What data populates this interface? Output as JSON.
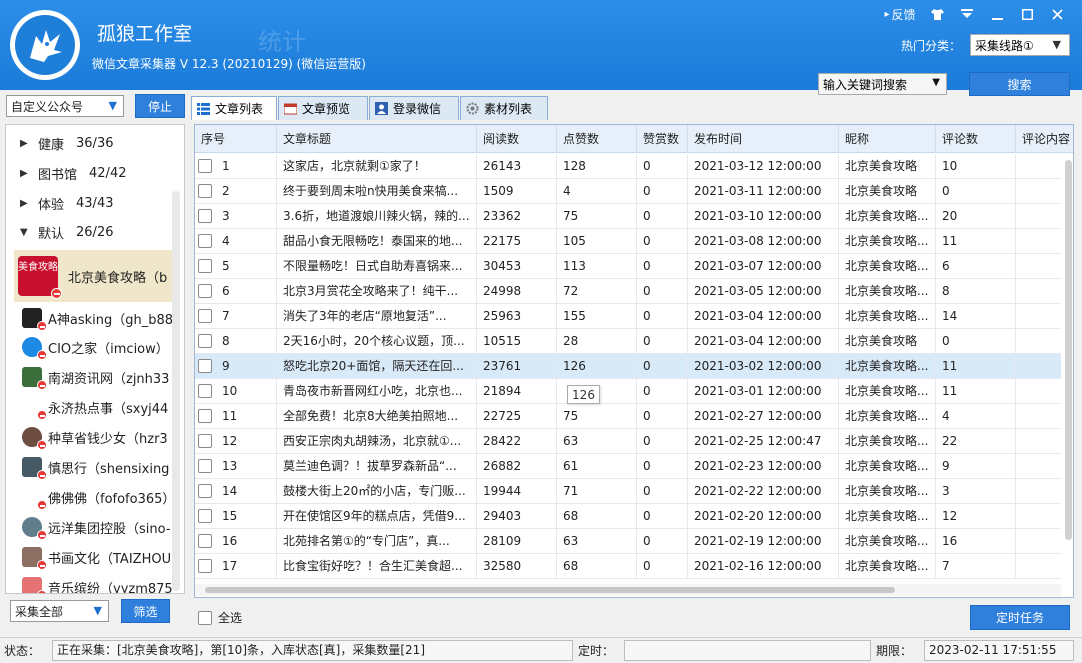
{
  "app": {
    "title": "孤狼工作室",
    "subtitle": "微信文章采集器  V 12.3 (20210129) (微信运营版)",
    "watermark": "统计"
  },
  "window_controls": {
    "feedback": "反馈",
    "feedback_icon": "chat-icon",
    "shirt_icon": "skin-icon",
    "menu_icon": "menu-icon",
    "minimize_icon": "minimize-icon",
    "maximize_icon": "maximize-icon",
    "close_icon": "close-icon"
  },
  "header": {
    "hot_label": "热门分类：",
    "line_select": "采集线路①",
    "keyword_select": "输入关键词搜索",
    "search_button": "搜索"
  },
  "left": {
    "account_type": "自定义公众号",
    "stop_button": "停止",
    "groups": [
      {
        "name": "健康",
        "count": "36/36",
        "expanded": false
      },
      {
        "name": "图书馆",
        "count": "42/42",
        "expanded": false
      },
      {
        "name": "体验",
        "count": "43/43",
        "expanded": false
      },
      {
        "name": "默认",
        "count": "26/26",
        "expanded": true
      }
    ],
    "selected_account": {
      "name": "北京美食攻略（b",
      "avatar_text": "美食攻略"
    },
    "accounts": [
      {
        "name": "A神asking（gh_b88",
        "avatar": "#222222"
      },
      {
        "name": "CIO之家（imciow）",
        "avatar": "#1e88e5"
      },
      {
        "name": "南湖资讯网（zjnh33",
        "avatar": "#3b6e3b"
      },
      {
        "name": "永济热点事（sxyj44",
        "avatar": ""
      },
      {
        "name": "种草省钱少女（hzr3",
        "avatar": "#6d4c41"
      },
      {
        "name": "慎思行（shensixing",
        "avatar": "#455a64"
      },
      {
        "name": "佛佛佛（fofofo365）",
        "avatar": ""
      },
      {
        "name": "远洋集团控股（sino-",
        "avatar": "#607d8b"
      },
      {
        "name": "书画文化（TAIZHOU",
        "avatar": "#8d6e63"
      },
      {
        "name": "音乐缤纷（yyzm875",
        "avatar": "#e57373"
      }
    ],
    "collect_select": "采集全部",
    "filter_button": "筛选"
  },
  "tabs": [
    {
      "label": "文章列表",
      "icon": "list-icon",
      "active": true
    },
    {
      "label": "文章预览",
      "icon": "preview-icon",
      "active": false
    },
    {
      "label": "登录微信",
      "icon": "user-icon",
      "active": false
    },
    {
      "label": "素材列表",
      "icon": "gear-icon",
      "active": false
    }
  ],
  "table": {
    "columns": [
      "序号",
      "文章标题",
      "阅读数",
      "点赞数",
      "赞赏数",
      "发布时间",
      "昵称",
      "评论数",
      "评论内容"
    ],
    "rows": [
      {
        "no": "1",
        "title": "这家店，北京就剩①家了！",
        "reads": "26143",
        "likes": "128",
        "rewards": "0",
        "time": "2021-03-12 12:00:00",
        "nick": "北京美食攻略",
        "comments": "10"
      },
      {
        "no": "2",
        "title": "终于要到周末啦n快用美食来犒...",
        "reads": "1509",
        "likes": "4",
        "rewards": "0",
        "time": "2021-03-11 12:00:00",
        "nick": "北京美食攻略",
        "comments": "0"
      },
      {
        "no": "3",
        "title": "3.6折，地道渡娘川辣火锅，辣的...",
        "reads": "23362",
        "likes": "75",
        "rewards": "0",
        "time": "2021-03-10 12:00:00",
        "nick": "北京美食攻略...",
        "comments": "20"
      },
      {
        "no": "4",
        "title": "甜品小食无限畅吃！泰国来的地...",
        "reads": "22175",
        "likes": "105",
        "rewards": "0",
        "time": "2021-03-08 12:00:00",
        "nick": "北京美食攻略...",
        "comments": "11"
      },
      {
        "no": "5",
        "title": "不限量畅吃！日式自助寿喜锅来...",
        "reads": "30453",
        "likes": "113",
        "rewards": "0",
        "time": "2021-03-07 12:00:00",
        "nick": "北京美食攻略...",
        "comments": "6"
      },
      {
        "no": "6",
        "title": "北京3月赏花全攻略来了！纯干...",
        "reads": "24998",
        "likes": "72",
        "rewards": "0",
        "time": "2021-03-05 12:00:00",
        "nick": "北京美食攻略...",
        "comments": "8"
      },
      {
        "no": "7",
        "title": "消失了3年的老店“原地复活”...",
        "reads": "25963",
        "likes": "155",
        "rewards": "0",
        "time": "2021-03-04 12:00:00",
        "nick": "北京美食攻略...",
        "comments": "14"
      },
      {
        "no": "8",
        "title": "2天16小时，20个核心议题，顶...",
        "reads": "10515",
        "likes": "28",
        "rewards": "0",
        "time": "2021-03-04 12:00:00",
        "nick": "北京美食攻略",
        "comments": "0"
      },
      {
        "no": "9",
        "title": "怒吃北京20+面馆，隔天还在回...",
        "reads": "23761",
        "likes": "126",
        "rewards": "0",
        "time": "2021-03-02 12:00:00",
        "nick": "北京美食攻略...",
        "comments": "11"
      },
      {
        "no": "10",
        "title": "青岛夜市新晋网红小吃，北京也...",
        "reads": "21894",
        "likes": "",
        "rewards": "0",
        "time": "2021-03-01 12:00:00",
        "nick": "北京美食攻略...",
        "comments": "11"
      },
      {
        "no": "11",
        "title": "全部免费！北京8大绝美拍照地...",
        "reads": "22725",
        "likes": "75",
        "rewards": "0",
        "time": "2021-02-27 12:00:00",
        "nick": "北京美食攻略...",
        "comments": "4"
      },
      {
        "no": "12",
        "title": "西安正宗肉丸胡辣汤，北京就①...",
        "reads": "28422",
        "likes": "63",
        "rewards": "0",
        "time": "2021-02-25 12:00:47",
        "nick": "北京美食攻略...",
        "comments": "22"
      },
      {
        "no": "13",
        "title": "莫兰迪色调？！拔草罗森新品“...",
        "reads": "26882",
        "likes": "61",
        "rewards": "0",
        "time": "2021-02-23 12:00:00",
        "nick": "北京美食攻略...",
        "comments": "9"
      },
      {
        "no": "14",
        "title": "鼓楼大街上20㎡的小店，专门贩...",
        "reads": "19944",
        "likes": "71",
        "rewards": "0",
        "time": "2021-02-22 12:00:00",
        "nick": "北京美食攻略...",
        "comments": "3"
      },
      {
        "no": "15",
        "title": "开在使馆区9年的糕点店，凭借9...",
        "reads": "29403",
        "likes": "68",
        "rewards": "0",
        "time": "2021-02-20 12:00:00",
        "nick": "北京美食攻略...",
        "comments": "12"
      },
      {
        "no": "16",
        "title": "北苑排名第①的“专门店”，真...",
        "reads": "28109",
        "likes": "63",
        "rewards": "0",
        "time": "2021-02-19 12:00:00",
        "nick": "北京美食攻略...",
        "comments": "16"
      },
      {
        "no": "17",
        "title": "比食宝街好吃？！合生汇美食超...",
        "reads": "32580",
        "likes": "68",
        "rewards": "0",
        "time": "2021-02-16 12:00:00",
        "nick": "北京美食攻略...",
        "comments": "7"
      }
    ],
    "highlighted_row": 9,
    "tooltip": "126"
  },
  "footer": {
    "select_all": "全选",
    "timer_button": "定时任务"
  },
  "status": {
    "label": "状态：",
    "text": "正在采集：[北京美食攻略]，第[10]条，入库状态[真]，采集数量[21]",
    "timer_label": "定时：",
    "timer_value": "",
    "expiry_label": "期限：",
    "expiry_value": "2023-02-11 17:51:55"
  }
}
